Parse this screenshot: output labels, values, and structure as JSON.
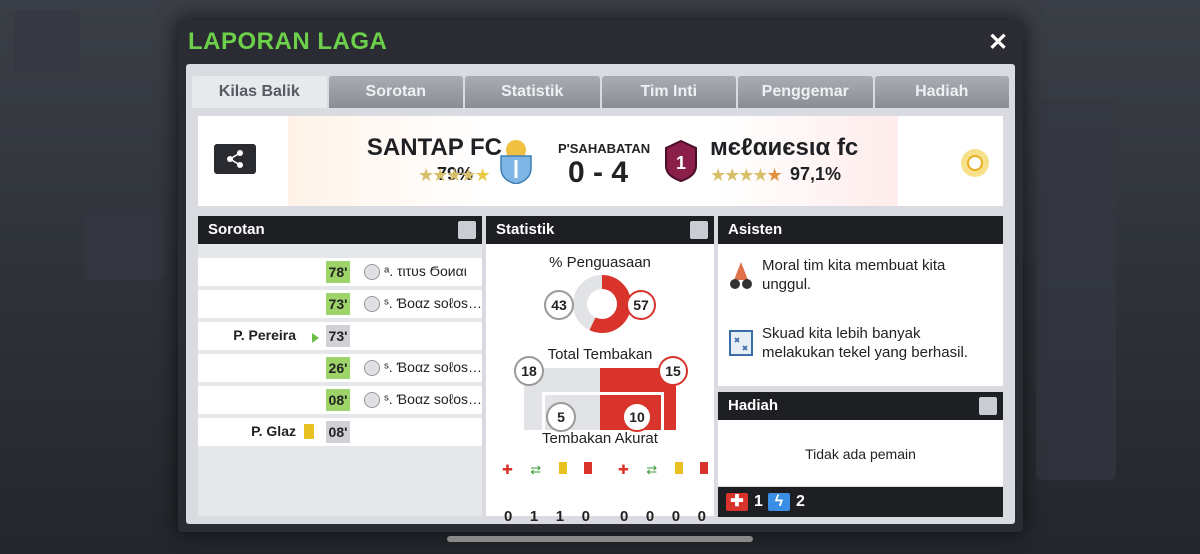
{
  "dialog": {
    "title": "LAPORAN LAGA"
  },
  "tabs": [
    "Kilas Balik",
    "Sorotan",
    "Statistik",
    "Tim Inti",
    "Penggemar",
    "Hadiah"
  ],
  "match": {
    "type": "P'SAHABATAN",
    "score": "0 - 4",
    "home": {
      "name": "SANTAP FC",
      "rating": "79%"
    },
    "away": {
      "name": "мєℓαиєѕια fc",
      "rating": "97,1%"
    }
  },
  "sorotan": {
    "title": "Sorotan",
    "events": [
      {
        "side": "away",
        "minute": "78'",
        "player": "ᵃ. τιτυѕ Ϭοиαι",
        "type": "goal"
      },
      {
        "side": "away",
        "minute": "73'",
        "player": "ˢ. Ɓοαz ѕοℓοѕ…",
        "type": "goal"
      },
      {
        "side": "home",
        "minute": "73'",
        "player": "P. Pereira",
        "type": "sub"
      },
      {
        "side": "away",
        "minute": "26'",
        "player": "ˢ. Ɓοαz ѕοℓοѕ…",
        "type": "goal"
      },
      {
        "side": "away",
        "minute": "08'",
        "player": "ˢ. Ɓοαz ѕοℓοѕ…",
        "type": "goal"
      },
      {
        "side": "home",
        "minute": "08'",
        "player": "P. Glaz",
        "type": "yellow"
      }
    ]
  },
  "statistik": {
    "title": "Statistik",
    "possession_label": "% Penguasaan",
    "possession_home": "43",
    "possession_away": "57",
    "shots_label": "Total Tembakan",
    "shots_home": "18",
    "shots_away": "15",
    "accurate_label": "Tembakan Akurat",
    "accurate_home": "5",
    "accurate_away": "10",
    "home_counts": [
      "0",
      "1",
      "1",
      "0"
    ],
    "away_counts": [
      "0",
      "0",
      "0",
      "0"
    ]
  },
  "asisten": {
    "title": "Asisten",
    "tips": [
      "Moral tim kita membuat kita unggul.",
      "Skuad kita lebih banyak melakukan tekel yang berhasil."
    ]
  },
  "hadiah": {
    "title": "Hadiah",
    "empty": "Tidak ada pemain",
    "health": "1",
    "energy": "2"
  },
  "colors": {
    "accent": "#6cd04a",
    "away": "#d9342b",
    "green_minute": "#9ed36a"
  }
}
